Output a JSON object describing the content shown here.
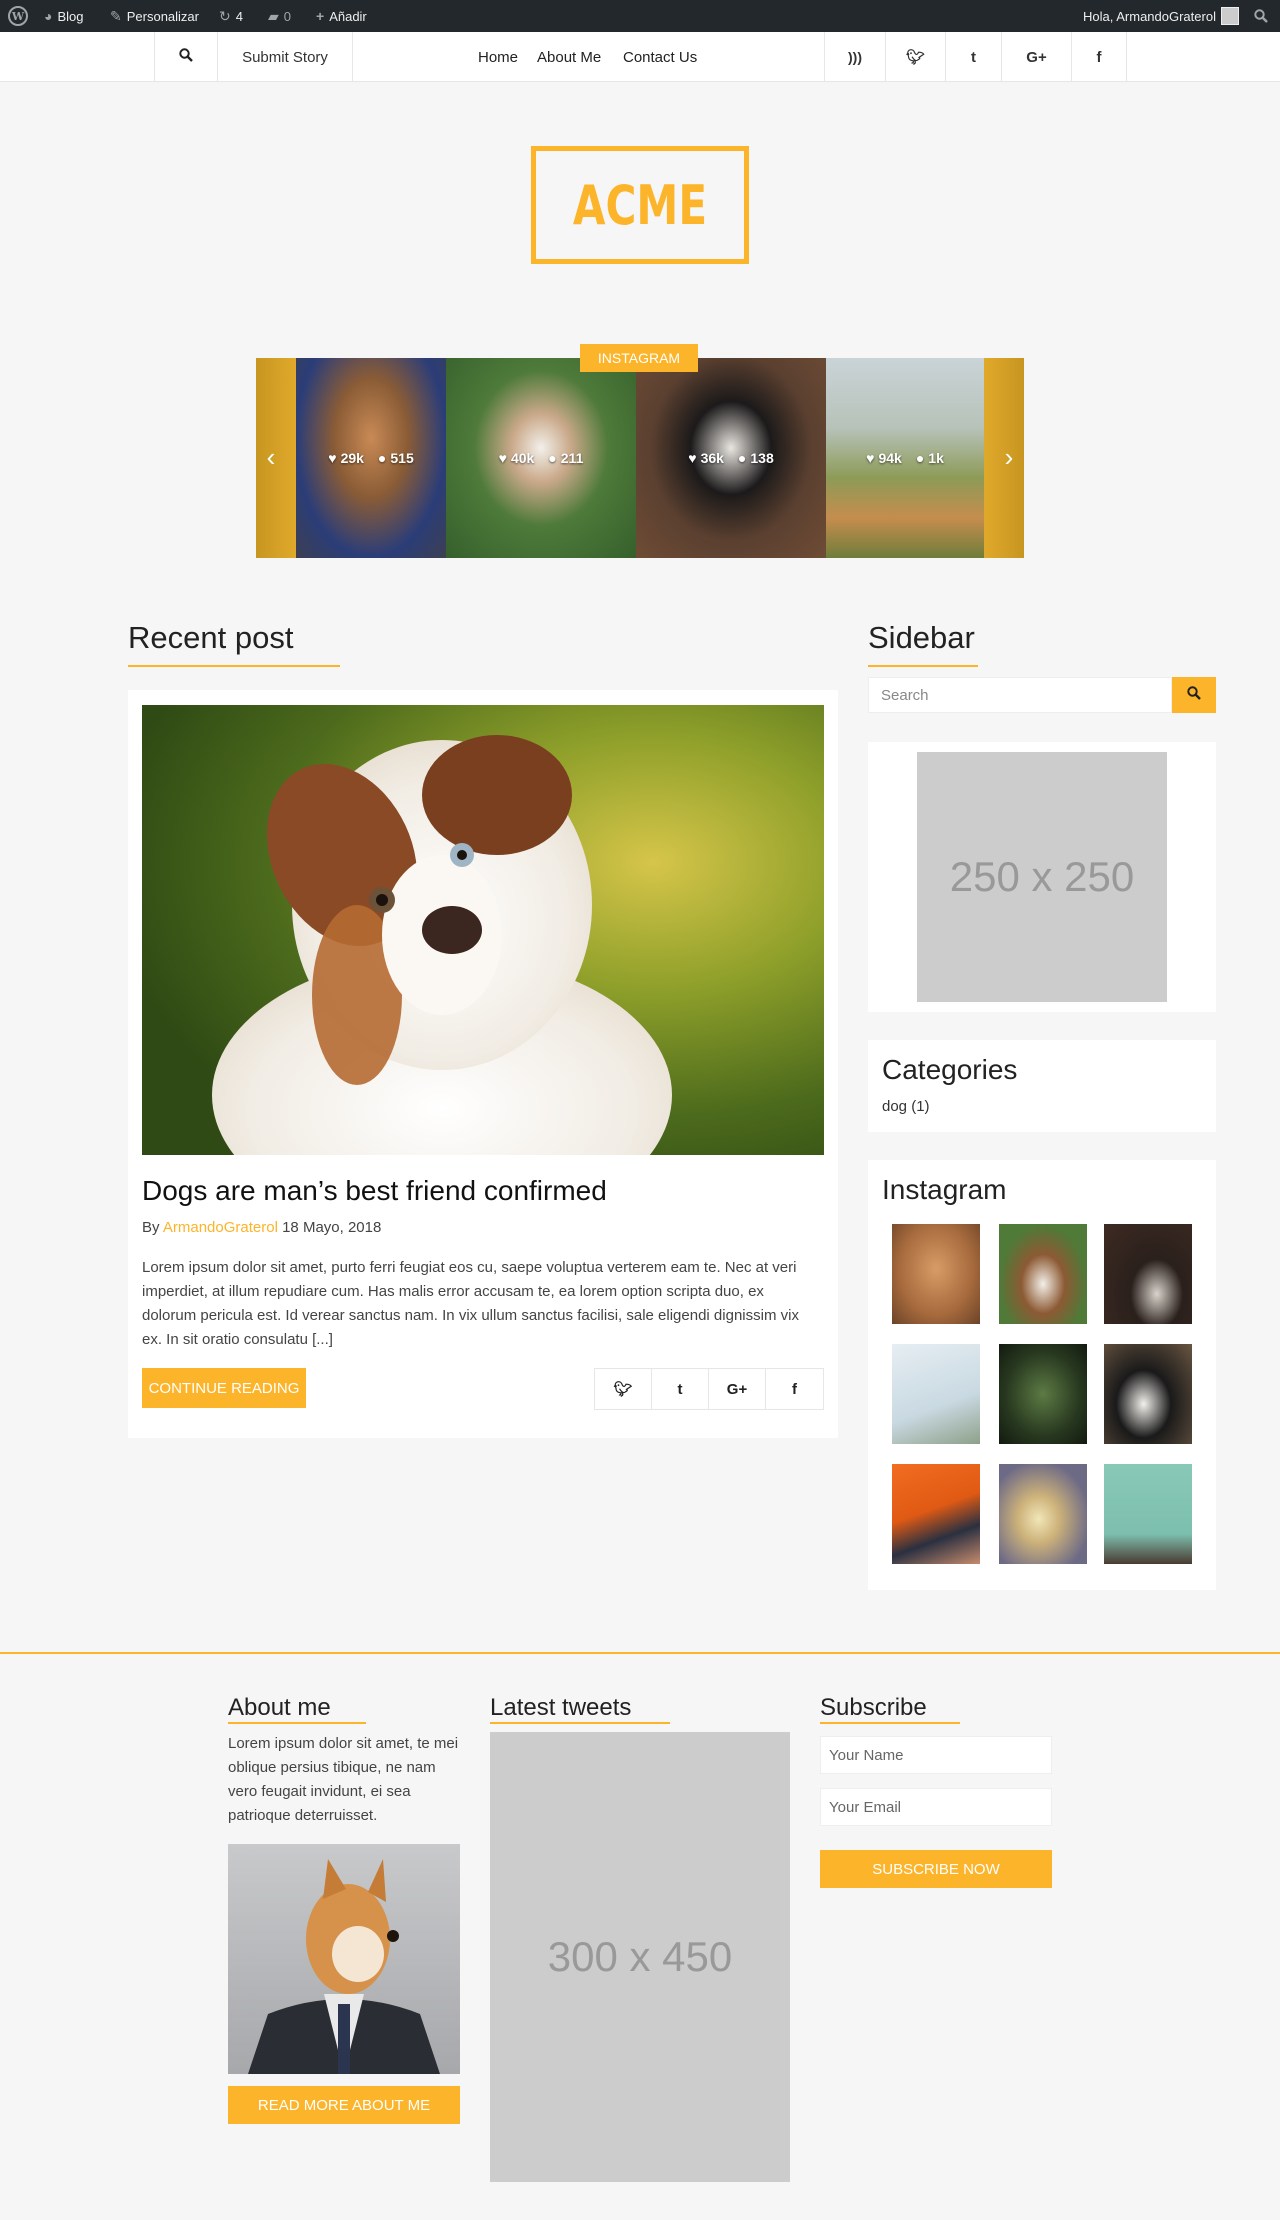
{
  "admin_bar": {
    "site": "Blog",
    "customize": "Personalizar",
    "updates": "4",
    "comments": "0",
    "add_new": "Añadir",
    "greeting": "Hola, ArmandoGraterol"
  },
  "nav": {
    "submit_story": "Submit Story",
    "links": [
      "Home",
      "About Me",
      "Contact Us"
    ],
    "social": [
      "rss-icon",
      "twitter-icon",
      "tumblr-icon",
      "google-plus-icon",
      "facebook-icon"
    ]
  },
  "logo": {
    "text": "ACME"
  },
  "instagram_slider": {
    "badge": "INSTAGRAM",
    "items": [
      {
        "likes": "29k",
        "comments": "515"
      },
      {
        "likes": "40k",
        "comments": "211"
      },
      {
        "likes": "36k",
        "comments": "138"
      },
      {
        "likes": "94k",
        "comments": "1k"
      }
    ]
  },
  "main": {
    "title": "Recent post",
    "post": {
      "title": "Dogs are man’s best friend confirmed",
      "by": "By",
      "author": "ArmandoGraterol",
      "date": "18 Mayo, 2018",
      "excerpt": "Lorem ipsum dolor sit amet, purto ferri feugiat eos cu, saepe voluptua verterem eam te. Nec at veri imperdiet, at illum repudiare cum. Has malis error accusam te, ea lorem option scripta duo, ex dolorum pericula est. Id verear sanctus nam. In vix ullum sanctus facilisi, sale eligendi dignissim vix ex. In sit oratio consulatu [...]",
      "continue": "CONTINUE READING",
      "share": [
        "twitter-icon",
        "tumblr-icon",
        "google-plus-icon",
        "facebook-icon"
      ]
    }
  },
  "sidebar": {
    "title": "Sidebar",
    "search_placeholder": "Search",
    "ad_label": "250 x 250",
    "categories_title": "Categories",
    "category": "dog (1)",
    "instagram_title": "Instagram"
  },
  "footer": {
    "about_title": "About me",
    "about_text": "Lorem ipsum dolor sit amet, te mei oblique persius tibique, ne nam vero feugait invidunt, ei sea patrioque deterruisset.",
    "about_button": "READ MORE ABOUT ME",
    "tweets_title": "Latest tweets",
    "tweets_placeholder": "300 x 450",
    "subscribe_title": "Subscribe",
    "name_placeholder": "Your Name",
    "email_placeholder": "Your Email",
    "subscribe_button": "SUBSCRIBE NOW"
  },
  "colors": {
    "accent": "#fcb42a",
    "adminbar": "#23282d",
    "background": "#f6f6f6"
  }
}
